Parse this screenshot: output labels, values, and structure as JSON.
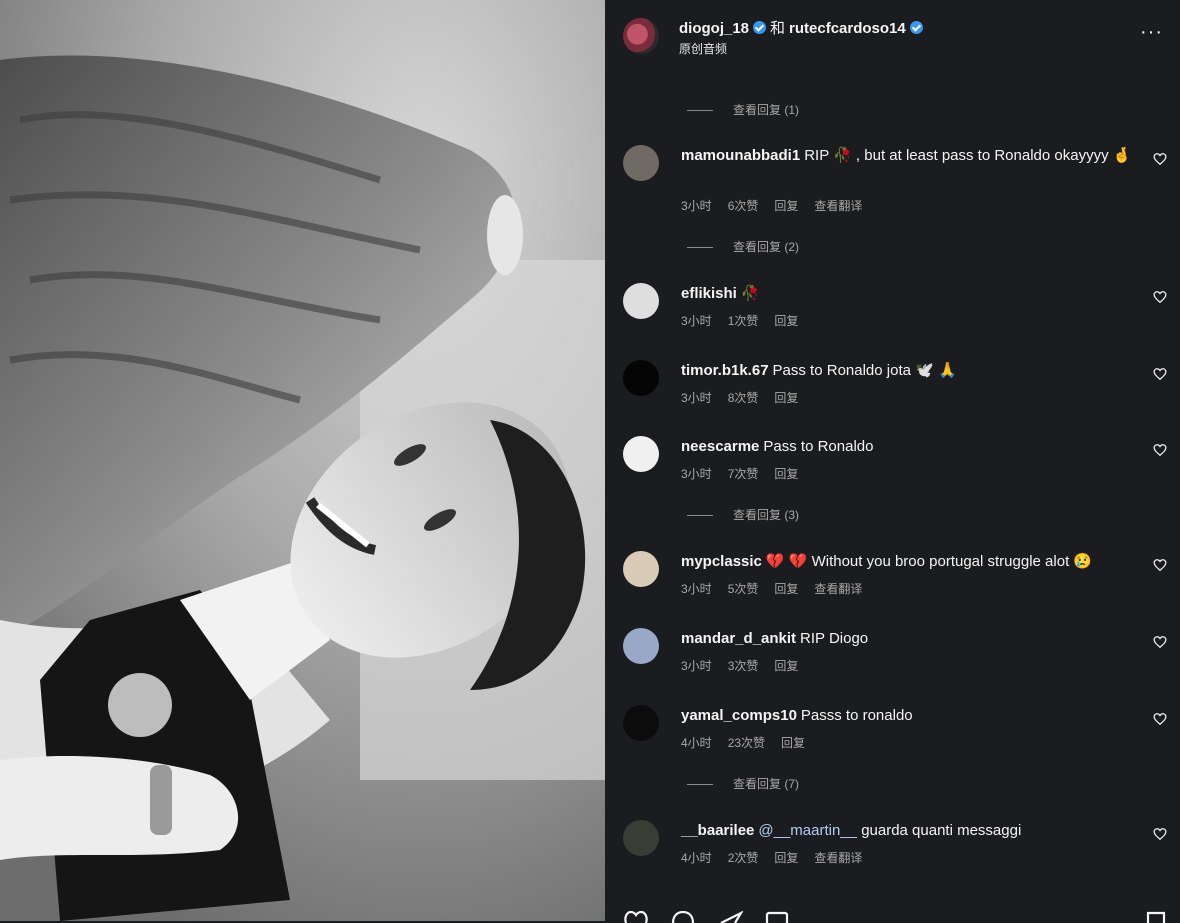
{
  "post": {
    "author1": "diogoj_18",
    "joiner": "和",
    "author2": "rutecfcardoso14",
    "audio": "原创音频",
    "more_label": "···"
  },
  "comments": [
    {
      "type": "viewreplies",
      "label": "查看回复 (1)"
    },
    {
      "type": "comment",
      "user": "mamounabbadi1",
      "text": "RIP 🥀 , but at least pass to Ronaldo okayyyy 🤞",
      "time": "3小时",
      "likes": "6次赞",
      "reply": "回复",
      "translate": "查看翻译",
      "avatar": "#6f6a64"
    },
    {
      "type": "viewreplies",
      "label": "查看回复 (2)"
    },
    {
      "type": "comment",
      "user": "eflikishi",
      "text": "🥀",
      "time": "3小时",
      "likes": "1次赞",
      "reply": "回复",
      "translate": "",
      "avatar": "#dedede"
    },
    {
      "type": "comment",
      "user": "timor.b1k.67",
      "text": "Pass to Ronaldo jota 🕊️ 🙏",
      "time": "3小时",
      "likes": "8次赞",
      "reply": "回复",
      "translate": "",
      "avatar": "#050505"
    },
    {
      "type": "comment",
      "user": "neescarme",
      "text": "Pass to Ronaldo",
      "time": "3小时",
      "likes": "7次赞",
      "reply": "回复",
      "translate": "",
      "avatar": "#f0f0f0"
    },
    {
      "type": "viewreplies",
      "label": "查看回复 (3)"
    },
    {
      "type": "comment",
      "user": "mypclassic",
      "text": "💔 💔 Without you broo portugal struggle alot 😢",
      "time": "3小时",
      "likes": "5次赞",
      "reply": "回复",
      "translate": "查看翻译",
      "avatar": "#d9cbb8"
    },
    {
      "type": "comment",
      "user": "mandar_d_ankit",
      "text": "RIP Diogo",
      "time": "3小时",
      "likes": "3次赞",
      "reply": "回复",
      "translate": "",
      "avatar": "#9aa8c8"
    },
    {
      "type": "comment",
      "user": "yamal_comps10",
      "text": "Passs to ronaldo",
      "time": "4小时",
      "likes": "23次赞",
      "reply": "回复",
      "translate": "",
      "avatar": "#0c0c0c"
    },
    {
      "type": "viewreplies",
      "label": "查看回复 (7)"
    },
    {
      "type": "comment",
      "user": "__baarilee",
      "mention": "@__maartin__",
      "text": "guarda quanti messaggi",
      "time": "4小时",
      "likes": "2次赞",
      "reply": "回复",
      "translate": "查看翻译",
      "avatar": "#3a3d35"
    }
  ],
  "icons": [
    "verified-badge-icon",
    "more-icon",
    "heart-icon",
    "comment-icon",
    "share-icon",
    "bookmark-icon"
  ]
}
